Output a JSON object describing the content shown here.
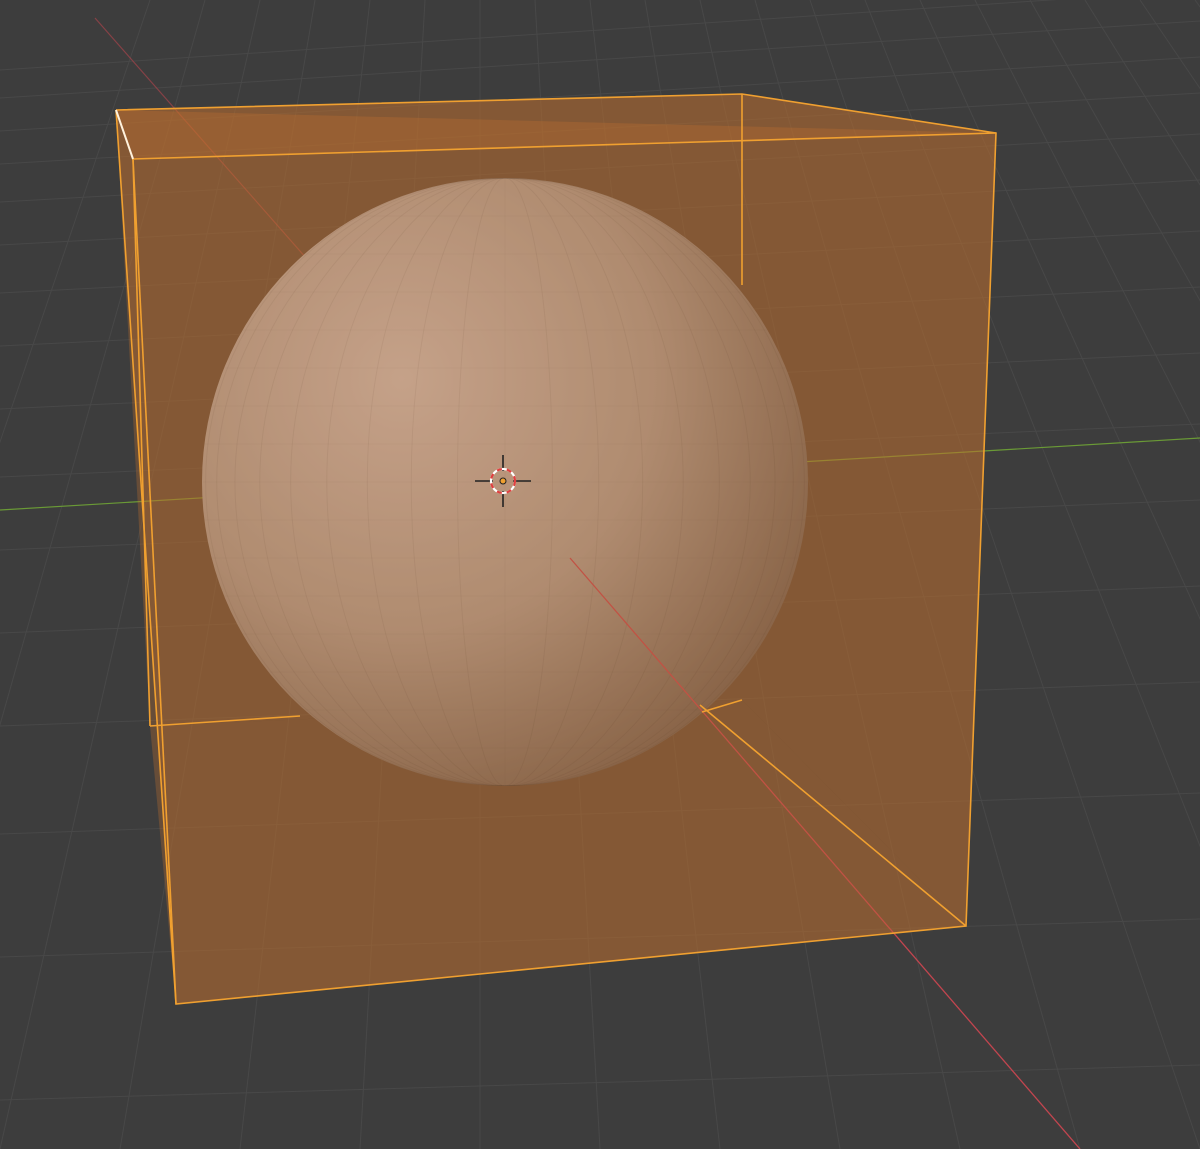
{
  "viewport": {
    "background_color": "#3d3d3d",
    "grid_color": "#484848",
    "x_axis_color": "#c2454f",
    "y_axis_color": "#6a9a36"
  },
  "cube": {
    "selected": true,
    "fill_color": "#c0712e",
    "outline_color": "#f0a030",
    "active_edge_color": "#fff2dd"
  },
  "sphere": {
    "base_color": "#a8998f",
    "highlight_color": "#c7b9b4",
    "shadow_color": "#6e5e53"
  },
  "cursor_3d": {
    "icon": "3d-cursor-icon",
    "ring_color_a": "#ffffff",
    "ring_color_b": "#e04040",
    "crosshair_color": "#222222"
  }
}
